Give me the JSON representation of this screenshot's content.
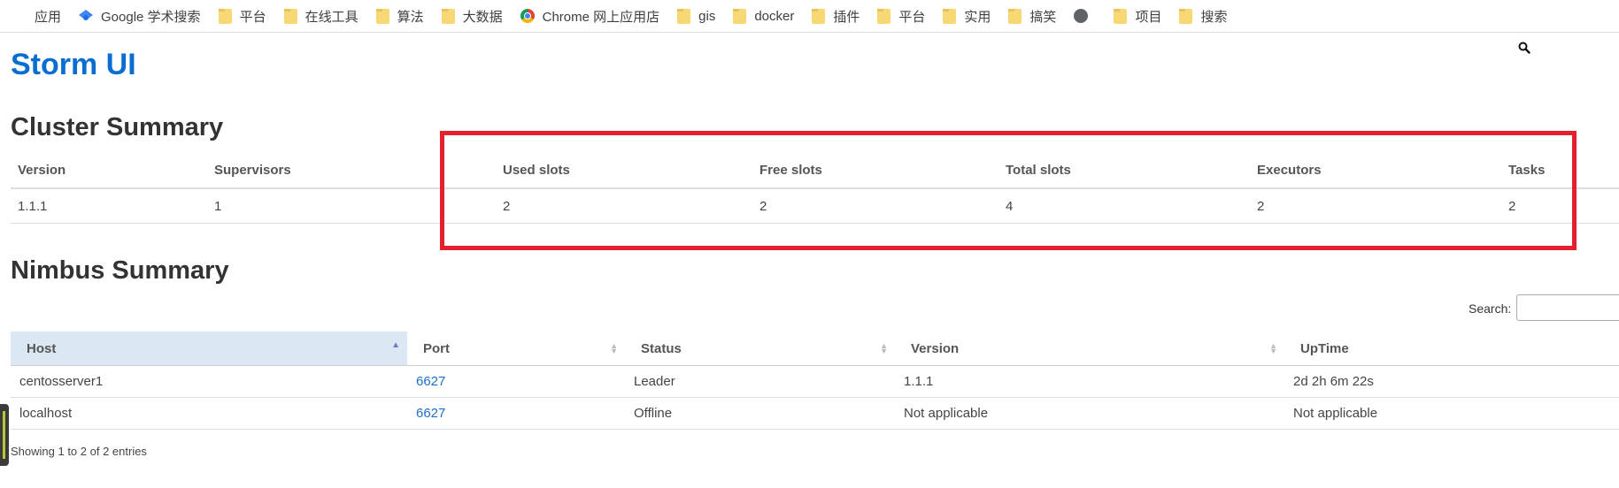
{
  "bookmarks": [
    {
      "label": "应用",
      "icon": "apps-grid-icon"
    },
    {
      "label": "Google 学术搜索",
      "icon": "google-scholar-icon"
    },
    {
      "label": "平台",
      "icon": "folder-icon"
    },
    {
      "label": "在线工具",
      "icon": "folder-icon"
    },
    {
      "label": "算法",
      "icon": "folder-icon"
    },
    {
      "label": "大数据",
      "icon": "folder-icon"
    },
    {
      "label": "Chrome 网上应用店",
      "icon": "chrome-web-store-icon"
    },
    {
      "label": "gis",
      "icon": "folder-icon"
    },
    {
      "label": "docker",
      "icon": "folder-icon"
    },
    {
      "label": "插件",
      "icon": "folder-icon"
    },
    {
      "label": "平台",
      "icon": "folder-icon"
    },
    {
      "label": "实用",
      "icon": "folder-icon"
    },
    {
      "label": "搞笑",
      "icon": "folder-icon"
    },
    {
      "label": "",
      "icon": "globe-icon"
    },
    {
      "label": "项目",
      "icon": "folder-icon"
    },
    {
      "label": "搜索",
      "icon": "folder-icon"
    }
  ],
  "page": {
    "logo": "Storm UI",
    "accent_color": "#0a6ed1",
    "highlight_color": "#e3202b"
  },
  "cluster_summary": {
    "title": "Cluster Summary",
    "headers": [
      "Version",
      "Supervisors",
      "Used slots",
      "Free slots",
      "Total slots",
      "Executors",
      "Tasks"
    ],
    "row": [
      "1.1.1",
      "1",
      "2",
      "2",
      "4",
      "2",
      "2"
    ]
  },
  "nimbus_summary": {
    "title": "Nimbus Summary",
    "search_label": "Search:",
    "search_value": "",
    "headers": [
      "Host",
      "Port",
      "Status",
      "Version",
      "UpTime"
    ],
    "rows": [
      [
        "centosserver1",
        "6627",
        "Leader",
        "1.1.1",
        "2d 2h 6m 22s"
      ],
      [
        "localhost",
        "6627",
        "Offline",
        "Not applicable",
        "Not applicable"
      ]
    ],
    "info": "Showing 1 to 2 of 2 entries"
  }
}
